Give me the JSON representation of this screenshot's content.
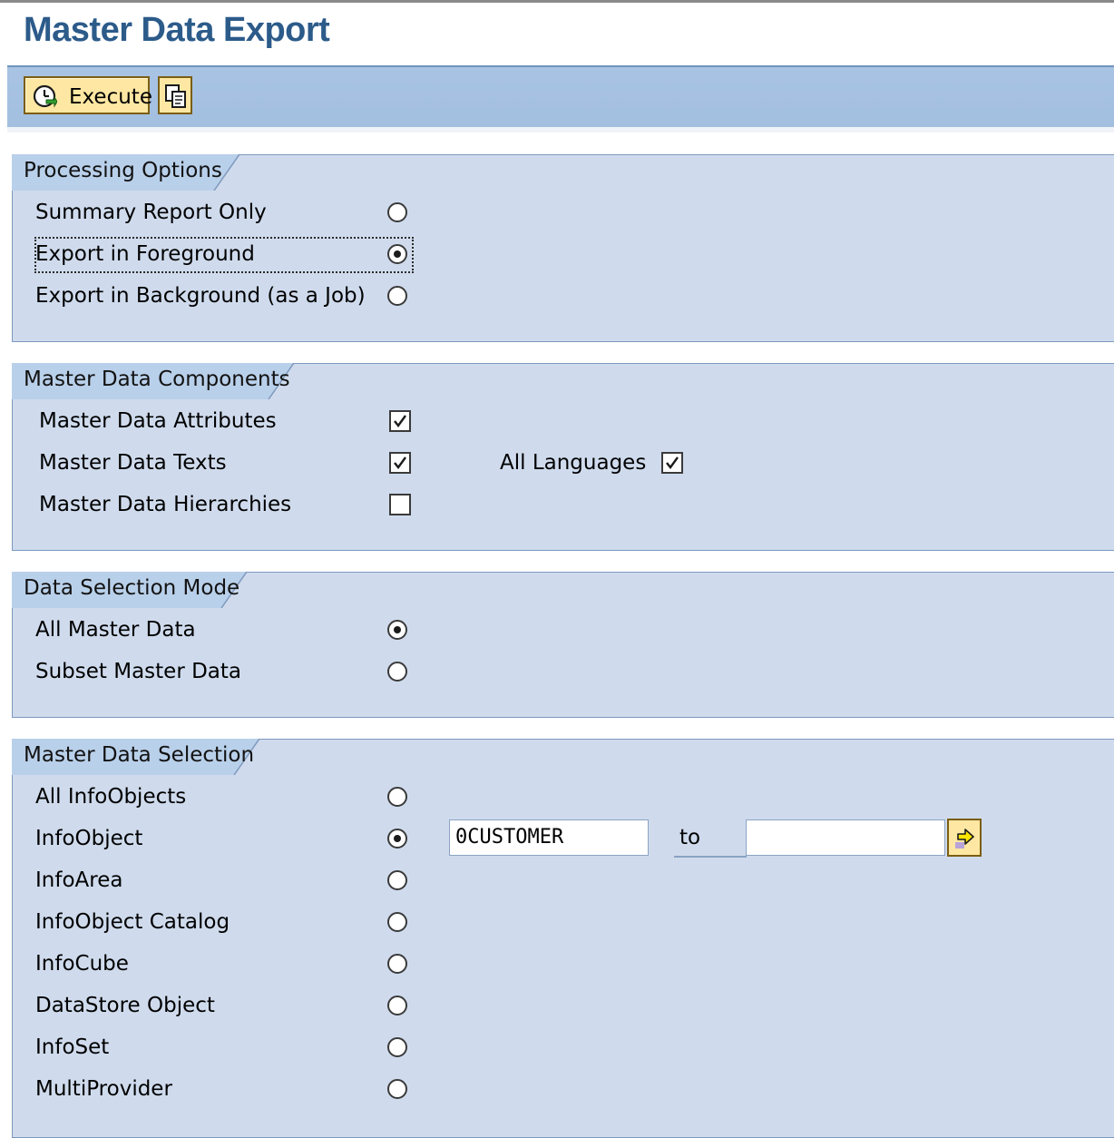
{
  "page": {
    "title": "Master Data Export"
  },
  "toolbar": {
    "execute_label": "Execute",
    "execute_icon": "clock-execute-icon",
    "copy_icon": "copy-variant-icon"
  },
  "processing_options": {
    "title": "Processing Options",
    "options": [
      {
        "label": "Summary Report Only",
        "selected": false
      },
      {
        "label": "Export in Foreground",
        "selected": true
      },
      {
        "label": "Export in Background (as a Job)",
        "selected": false
      }
    ]
  },
  "components": {
    "title": "Master Data Components",
    "items": [
      {
        "label": "Master Data Attributes",
        "checked": true
      },
      {
        "label": "Master Data Texts",
        "checked": true
      },
      {
        "label": "Master Data Hierarchies",
        "checked": false
      }
    ],
    "all_languages": {
      "label": "All Languages",
      "checked": true
    }
  },
  "selection_mode": {
    "title": "Data Selection Mode",
    "options": [
      {
        "label": "All Master Data",
        "selected": true
      },
      {
        "label": "Subset Master Data",
        "selected": false
      }
    ]
  },
  "selection": {
    "title": "Master Data Selection",
    "options": [
      {
        "label": "All InfoObjects",
        "selected": false
      },
      {
        "label": "InfoObject",
        "selected": true
      },
      {
        "label": "InfoArea",
        "selected": false
      },
      {
        "label": "InfoObject Catalog",
        "selected": false
      },
      {
        "label": "InfoCube",
        "selected": false
      },
      {
        "label": "DataStore Object",
        "selected": false
      },
      {
        "label": "InfoSet",
        "selected": false
      },
      {
        "label": "MultiProvider",
        "selected": false
      }
    ],
    "from_value": "0CUSTOMER",
    "to_label": "to",
    "to_value": "",
    "multiple_selection_icon": "arrow-right-icon"
  },
  "colors": {
    "title": "#2c5b8a",
    "toolbar": "#a8c3e3",
    "group_bg": "#cfdbed",
    "group_tab": "#b9d0ea",
    "button": "#fde7a2"
  }
}
